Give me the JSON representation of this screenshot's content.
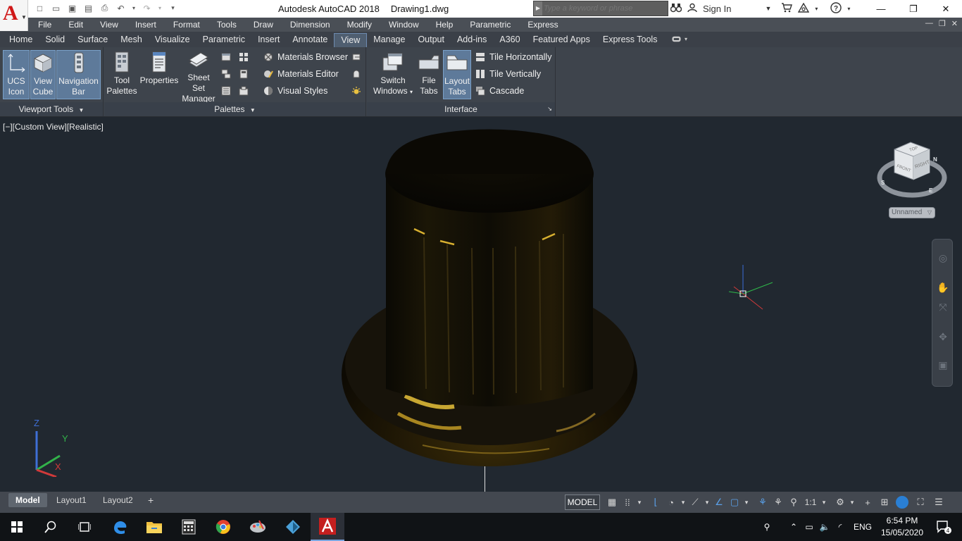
{
  "titlebar": {
    "app_name": "Autodesk AutoCAD 2018",
    "document": "Drawing1.dwg",
    "search_placeholder": "Type a keyword or phrase",
    "sign_in": "Sign In",
    "logo_letter": "A"
  },
  "menu": [
    "File",
    "Edit",
    "View",
    "Insert",
    "Format",
    "Tools",
    "Draw",
    "Dimension",
    "Modify",
    "Window",
    "Help",
    "Parametric",
    "Express"
  ],
  "ribbon_tabs": [
    "Home",
    "Solid",
    "Surface",
    "Mesh",
    "Visualize",
    "Parametric",
    "Insert",
    "Annotate",
    "View",
    "Manage",
    "Output",
    "Add-ins",
    "A360",
    "Featured Apps",
    "Express Tools"
  ],
  "active_ribbon_tab": "View",
  "ribbon": {
    "viewport_tools": {
      "title": "Viewport Tools",
      "ucs_icon": [
        "UCS",
        "Icon"
      ],
      "view_cube": [
        "View",
        "Cube"
      ],
      "navigation_bar": [
        "Navigation",
        "Bar"
      ]
    },
    "palettes": {
      "title": "Palettes",
      "tool_palettes": [
        "Tool",
        "Palettes"
      ],
      "properties": "Properties",
      "sheet_set_manager": [
        "Sheet Set",
        "Manager"
      ],
      "materials_browser": "Materials Browser",
      "materials_editor": "Materials Editor",
      "visual_styles": "Visual Styles"
    },
    "interface": {
      "title": "Interface",
      "switch_windows": [
        "Switch",
        "Windows"
      ],
      "file_tabs": [
        "File",
        "Tabs"
      ],
      "layout_tabs": [
        "Layout",
        "Tabs"
      ],
      "tile_horizontally": "Tile Horizontally",
      "tile_vertically": "Tile Vertically",
      "cascade": "Cascade"
    }
  },
  "viewport": {
    "label": "[−][Custom View][Realistic]",
    "viewcube_faces": {
      "top": "TOP",
      "front": "FRONT",
      "right": "RIGHT"
    },
    "compass": {
      "n": "N",
      "s": "S",
      "e": "E"
    },
    "ucs_named": "Unnamed",
    "ucs_axes": {
      "x": "X",
      "y": "Y",
      "z": "Z"
    }
  },
  "layout_tabs": [
    "Model",
    "Layout1",
    "Layout2"
  ],
  "status": {
    "model": "MODEL",
    "scale": "1:1"
  },
  "taskbar": {
    "language": "ENG",
    "time": "6:54 PM",
    "date": "15/05/2020",
    "notifications": "4"
  },
  "colors": {
    "accent_blue": "#5e7a9a",
    "viewport_bg": "#212830",
    "ribbon_bg": "#3e444c",
    "autocad_red": "#d01818",
    "model_gold": "#caa032"
  }
}
